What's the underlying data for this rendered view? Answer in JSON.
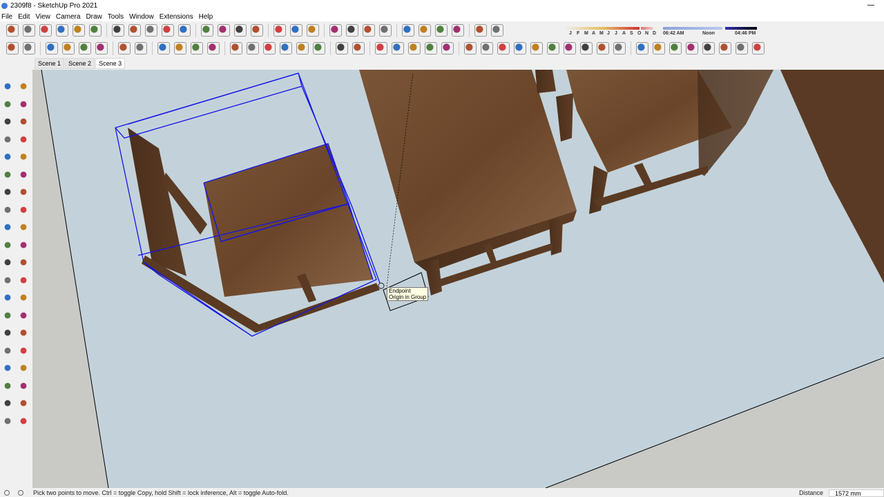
{
  "window": {
    "title": "2309f8 - SketchUp Pro 2021"
  },
  "menu": [
    "File",
    "Edit",
    "View",
    "Camera",
    "Draw",
    "Tools",
    "Window",
    "Extensions",
    "Help"
  ],
  "toolbar_top": [
    "iso-view-icon",
    "top-view-icon",
    "front-view-icon",
    "right-view-icon",
    "back-view-icon",
    "left-view-icon",
    "|",
    "select-icon",
    "eraser-icon",
    "pencil-icon",
    "arc-icon",
    "rectangle-icon",
    "|",
    "push-pull-icon",
    "follow-me-icon",
    "move-icon",
    "rotate-icon",
    "|",
    "tape-measure-icon",
    "text-icon",
    "paint-bucket-icon",
    "|",
    "orbit-icon",
    "pan-icon",
    "zoom-icon",
    "zoom-extents-icon",
    "|",
    "warehouse-icon",
    "sandbox-icon",
    "layers-icon",
    "styles-icon",
    "|",
    "geo-icon",
    "shadows-toggle-icon"
  ],
  "toolbar_second": [
    "model-info-icon",
    "materials-icon",
    "|",
    "teapot-icon",
    "teapot-hand-icon",
    "faded-icon",
    "refresh-icon",
    "|",
    "section-plane-icon",
    "section-fill-icon",
    "|",
    "window-icon",
    "windows-icon",
    "graph-icon",
    "lock-icon",
    "|",
    "component-icon",
    "box-icon",
    "box-plus-icon",
    "hidden-icon",
    "xray-icon",
    "grid-icon",
    "|",
    "group-icon",
    "outer-shell-icon",
    "|",
    "wireframe-icon",
    "hidden-line-icon",
    "shaded-icon",
    "textured-icon",
    "monochrome-icon",
    "|",
    "intersect-icon",
    "union-icon",
    "subtract-icon",
    "trim-icon",
    "split-icon",
    "protractor-icon",
    "axes-icon",
    "explode-icon",
    "dome-icon",
    "sphere-icon",
    "|",
    "tool-a-icon",
    "tool-b-icon",
    "tool-c-icon",
    "tool-d-icon",
    "tool-e-icon",
    "tool-f-icon",
    "tool-g-icon",
    "tool-h-icon"
  ],
  "shadow": {
    "months": [
      "J",
      "F",
      "M",
      "A",
      "M",
      "J",
      "J",
      "A",
      "S",
      "O",
      "N",
      "D"
    ],
    "time_start": "06:42 AM",
    "time_mid": "Noon",
    "time_end": "04:46 PM",
    "month_value": 11,
    "time_value": 0.94
  },
  "scenes": [
    "Scene 1",
    "Scene 2",
    "Scene 3"
  ],
  "active_scene": 2,
  "left_toolbar": [
    "select-icon",
    "make-component-icon",
    "paint-icon",
    "eraser-icon",
    "line-icon",
    "freehand-icon",
    "rectangle-icon",
    "rotated-rect-icon",
    "circle-icon",
    "polygon-icon",
    "arc-icon",
    "pie-icon",
    "two-point-arc-icon",
    "three-point-arc-icon",
    "move-icon",
    "push-pull-icon",
    "rotate-icon",
    "follow-me-icon",
    "scale-icon",
    "offset-icon",
    "tape-icon",
    "dimension-icon",
    "protractor-icon",
    "text-icon",
    "axes-icon",
    "3d-text-icon",
    "orbit-icon",
    "pan-icon",
    "zoom-icon",
    "zoom-window-icon",
    "zoom-extents-icon",
    "previous-icon",
    "position-camera-icon",
    "look-around-icon",
    "walk-icon",
    "section-icon",
    "sandbox-a-icon",
    "sandbox-b-icon",
    "sandbox-c-icon",
    "sandbox-d-icon"
  ],
  "tooltip": {
    "line1": "Endpoint",
    "line2": "Origin in Group"
  },
  "status": {
    "message": "Pick two points to move.  Ctrl = toggle Copy, hold Shift = lock inference, Alt = toggle Auto-fold.",
    "distance_label": "Distance",
    "distance_value": "1572 mm"
  },
  "colors": {
    "viewport": "#c3d2da",
    "ground": "#c9c9c5",
    "wood": "#6b4a30",
    "selection": "#1010e0"
  }
}
